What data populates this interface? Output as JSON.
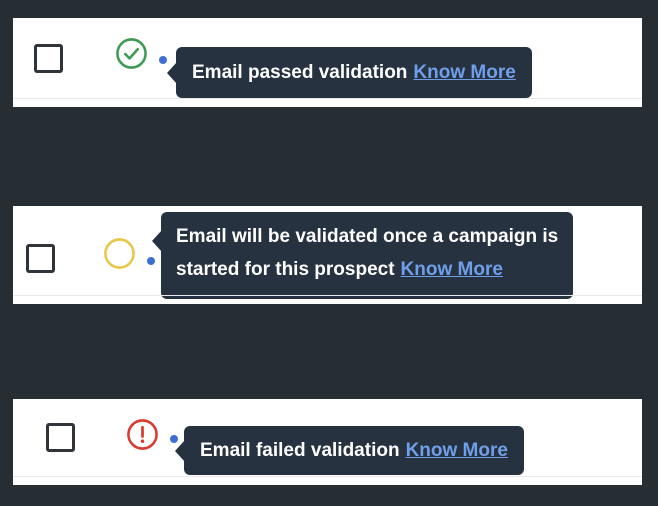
{
  "rows": [
    {
      "status": "passed",
      "icon": "check-circle-icon",
      "icon_color": "#3c9a52",
      "tooltip_text": "Email passed validation",
      "link_label": "Know More"
    },
    {
      "status": "pending",
      "icon": "empty-circle-icon",
      "icon_color": "#e8c648",
      "tooltip_line1": "Email will be validated once a campaign is",
      "tooltip_line2": "started for this prospect",
      "link_label": "Know More"
    },
    {
      "status": "failed",
      "icon": "alert-circle-icon",
      "icon_color": "#d9392e",
      "tooltip_text": "Email failed validation",
      "link_label": "Know More"
    }
  ],
  "colors": {
    "backdrop": "#262d33",
    "tooltip_bg": "#273240",
    "link": "#6f9fe8"
  }
}
